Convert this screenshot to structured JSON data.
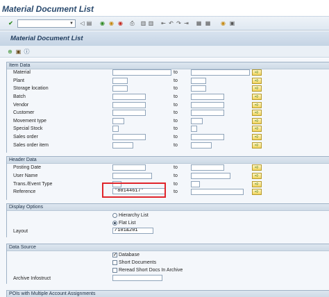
{
  "window": {
    "title": "Material Document List"
  },
  "toolbar": {
    "command_field": {
      "value": "",
      "placeholder": ""
    },
    "icons": [
      "enter-icon",
      "back-icon",
      "exit-icon",
      "cancel-icon",
      "print-icon",
      "find-icon",
      "find-next-icon",
      "first-page-icon",
      "prev-page-icon",
      "next-page-icon",
      "last-page-icon",
      "new-session-icon",
      "shortcut-icon",
      "help-icon",
      "customize-icon"
    ]
  },
  "screen": {
    "title": "Material Document List"
  },
  "app_toolbar": {
    "icons": [
      "execute-icon",
      "get-variant-icon",
      "info-icon"
    ]
  },
  "to_label": "to",
  "item_data": {
    "header": "Item Data",
    "fields": [
      {
        "label": "Material",
        "from": "",
        "to": ""
      },
      {
        "label": "Plant",
        "from": "",
        "to": ""
      },
      {
        "label": "Storage location",
        "from": "",
        "to": ""
      },
      {
        "label": "Batch",
        "from": "",
        "to": ""
      },
      {
        "label": "Vendor",
        "from": "",
        "to": ""
      },
      {
        "label": "Customer",
        "from": "",
        "to": ""
      },
      {
        "label": "Movement type",
        "from": "",
        "to": ""
      },
      {
        "label": "Special Stock",
        "from": "",
        "to": ""
      },
      {
        "label": "Sales order",
        "from": "",
        "to": ""
      },
      {
        "label": "Sales order item",
        "from": "",
        "to": ""
      }
    ]
  },
  "header_data": {
    "header": "Header Data",
    "fields": [
      {
        "label": "Posting Date",
        "from": "",
        "to": ""
      },
      {
        "label": "User Name",
        "from": "",
        "to": ""
      },
      {
        "label": "Trans./Event Type",
        "from": "",
        "to": ""
      },
      {
        "label": "Reference",
        "from": "*80144617*",
        "to": ""
      }
    ]
  },
  "display_options": {
    "header": "Display Options",
    "hierarchy_list": "Hierarchy List",
    "flat_list": "Flat List",
    "selected": "flat_list",
    "layout_label": "Layout",
    "layout_value": "/101&201"
  },
  "data_source": {
    "header": "Data Source",
    "database": {
      "label": "Database",
      "checked": true
    },
    "short_documents": {
      "label": "Short Documents",
      "checked": false
    },
    "reread": {
      "label": "Reread Short Docs In Archive",
      "checked": false
    },
    "archive_label": "Archive Infostruct",
    "archive_value": ""
  },
  "next_group": {
    "header": "POIs with Multiple Account Assignments"
  },
  "colors": {
    "highlight": "#e0242a",
    "banner": "#c5d4e4",
    "title": "#2a4a6e"
  }
}
